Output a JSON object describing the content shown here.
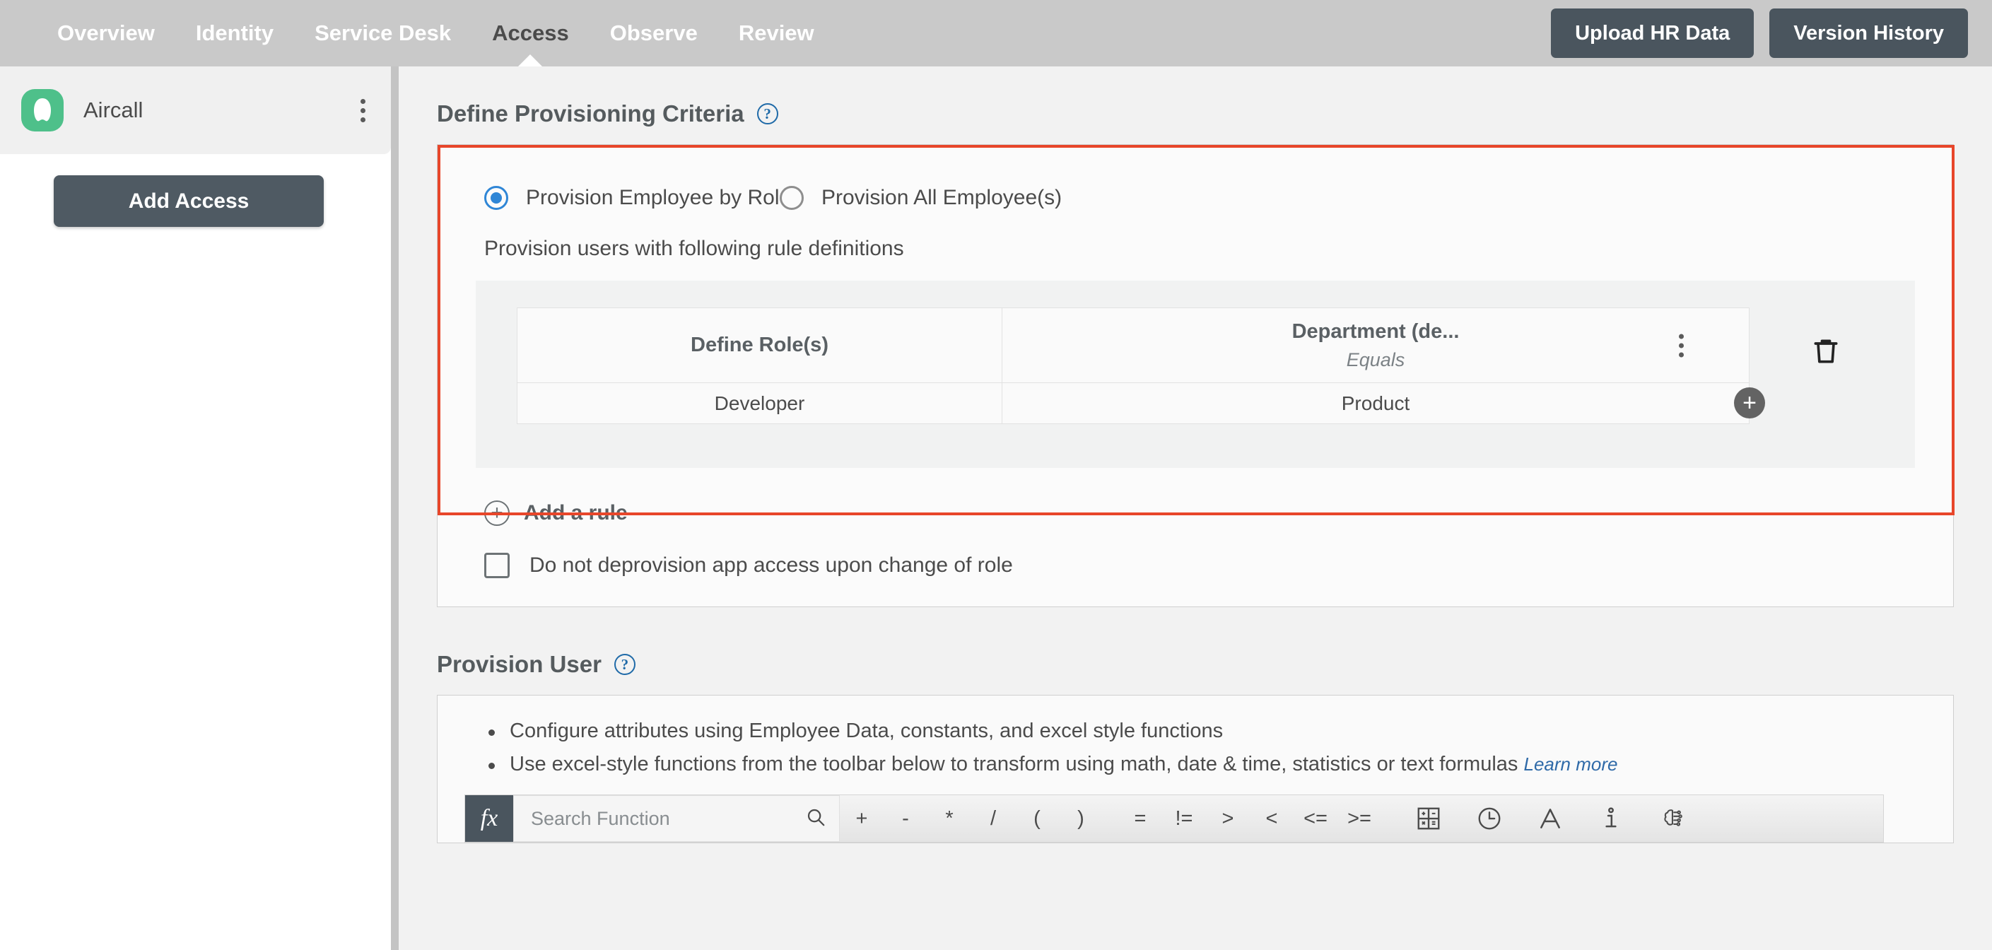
{
  "topnav": {
    "tabs": [
      {
        "label": "Overview",
        "active": false
      },
      {
        "label": "Identity",
        "active": false
      },
      {
        "label": "Service Desk",
        "active": false
      },
      {
        "label": "Access",
        "active": true
      },
      {
        "label": "Observe",
        "active": false
      },
      {
        "label": "Review",
        "active": false
      }
    ],
    "upload_button": "Upload HR Data",
    "version_button": "Version History"
  },
  "sidebar": {
    "app_name": "Aircall",
    "app_menu_icon": "kebab-menu-icon",
    "add_access_button": "Add Access"
  },
  "main": {
    "criteria": {
      "heading": "Define Provisioning Criteria",
      "help_icon": "help-circle-icon",
      "radio_by_role": "Provision Employee by Role",
      "radio_all": "Provision All Employee(s)",
      "radio_selected": "Provision Employee by Role",
      "rule_intro": "Provision users with following rule definitions",
      "table": {
        "headers": [
          "Define Role(s)",
          "Department (de..."
        ],
        "header_sub": "Equals",
        "row": [
          "Developer",
          "Product"
        ],
        "kebab_icon": "kebab-menu-icon",
        "add_column_icon": "plus-circle-icon",
        "delete_icon": "trash-icon"
      },
      "add_rule": "Add a rule",
      "add_rule_icon": "plus-circle-outline-icon",
      "checkbox_label": "Do not deprovision app access upon change of role",
      "checkbox_checked": false,
      "highlight_color": "#e8462a"
    },
    "provision_user": {
      "heading": "Provision User",
      "help_icon": "help-circle-icon",
      "bullets": [
        "Configure attributes using Employee Data, constants, and excel style functions",
        "Use excel-style functions from the toolbar below to transform using math, date & time, statistics or text formulas"
      ],
      "learn_more": "Learn more",
      "toolbar": {
        "fx_label": "fx",
        "search_placeholder": "Search Function",
        "search_value": "",
        "search_icon": "search-icon",
        "operators": [
          "+",
          "-",
          "*",
          "/",
          "(",
          ")",
          "=",
          "!=",
          ">",
          "<",
          "<=",
          ">="
        ],
        "icons": [
          {
            "name": "calculator-icon",
            "title": "Math"
          },
          {
            "name": "clock-icon",
            "title": "Date & Time"
          },
          {
            "name": "text-letter-a-icon",
            "title": "Text"
          },
          {
            "name": "info-icon",
            "title": "Info"
          },
          {
            "name": "ai-brain-icon",
            "title": "AI"
          }
        ]
      }
    }
  }
}
